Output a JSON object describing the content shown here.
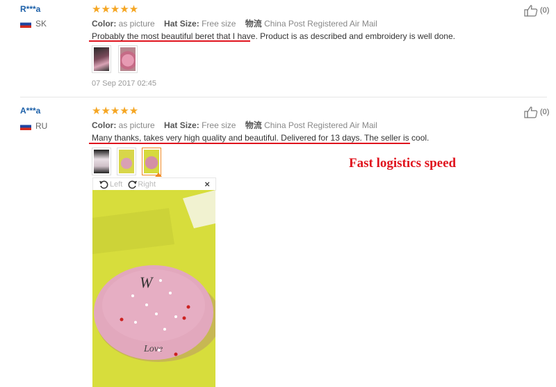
{
  "labels": {
    "color": "Color:",
    "hat_size": "Hat Size:",
    "shipping": "物流"
  },
  "reviews": [
    {
      "user": "R***a",
      "country": "SK",
      "stars": "★★★★★",
      "color": "as picture",
      "hat_size": "Free size",
      "shipping": "China Post Registered Air Mail",
      "text_underlined": "Probably the most beautiful beret that I have.",
      "text_rest": " Product is as described and embroidery is well done.",
      "date": "07 Sep 2017 02:45",
      "likes": "(0)"
    },
    {
      "user": "A***a",
      "country": "RU",
      "stars": "★★★★★",
      "color": "as picture",
      "hat_size": "Free size",
      "shipping": "China Post Registered Air Mail",
      "text_underlined": "Many thanks, takes very high quality and beautiful. Delivered for 13 days. The seller is cool.",
      "text_rest": "",
      "likes": "(0)"
    }
  ],
  "viewer": {
    "left_label": "Left",
    "right_label": "Right",
    "close": "×"
  },
  "annotation": "Fast logistics speed",
  "colors": {
    "star": "#f5a623",
    "accent_red": "#e0141e",
    "username": "#1b5fa8"
  }
}
